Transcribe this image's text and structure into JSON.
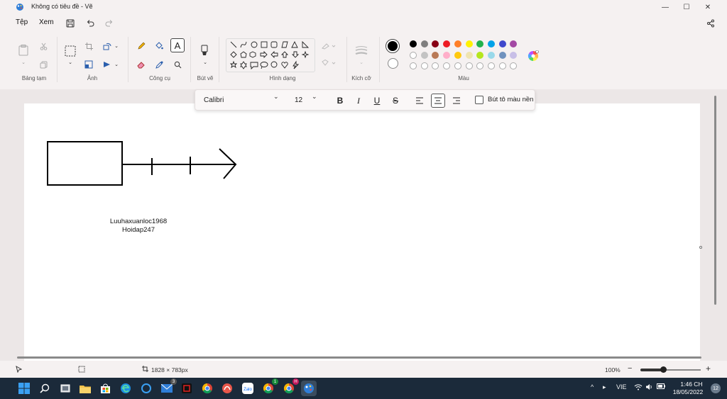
{
  "window": {
    "title": "Không có tiêu đề - Vẽ",
    "minimize": "—",
    "maximize": "☐",
    "close": "✕"
  },
  "menu": {
    "file": "Tệp",
    "view": "Xem"
  },
  "ribbon": {
    "groups": {
      "clipboard": "Bảng tạm",
      "image": "Ảnh",
      "tools": "Công cụ",
      "brushes": "Bút vẽ",
      "shapes": "Hình dạng",
      "size": "Kích cỡ",
      "colors": "Màu"
    },
    "palette_row1": [
      "#000000",
      "#7f7f7f",
      "#880015",
      "#ed1c24",
      "#ff7f27",
      "#fff200",
      "#22b14c",
      "#00a2e8",
      "#3f48cc",
      "#a349a4"
    ],
    "palette_row2": [
      "#ffffff",
      "#c3c3c3",
      "#b97a57",
      "#ffaec9",
      "#ffc90e",
      "#efe4b0",
      "#b5e61d",
      "#99d9ea",
      "#7092be",
      "#c8bfe7"
    ],
    "primary_color": "#000000",
    "secondary_color": "#ffffff"
  },
  "text_toolbar": {
    "font": "Calibri",
    "size": "12",
    "bold": "B",
    "italic": "I",
    "underline": "U",
    "strike": "S",
    "bg_fill_label": "Bút tô màu nền"
  },
  "canvas": {
    "text_line1": "Luuhaxuanloc1968",
    "text_line2": "Hoidap247"
  },
  "status": {
    "image_size": "1828 × 783px",
    "zoom": "100%",
    "zoom_level": 0.38
  },
  "taskbar": {
    "lang": "VIE",
    "time": "1:46 CH",
    "date": "18/05/2022",
    "notifications": "12",
    "mail_badge": "3",
    "chrome_badge1": "1",
    "chrome_badge2": "H"
  }
}
